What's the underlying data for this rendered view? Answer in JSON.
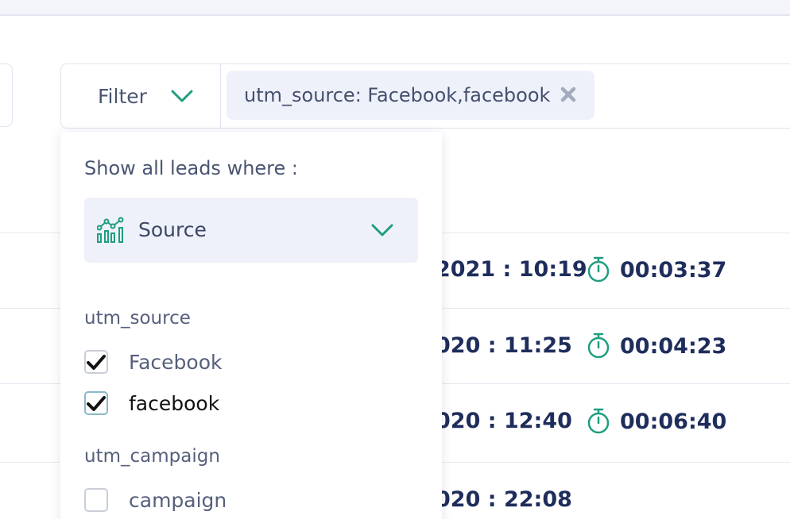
{
  "filter": {
    "label": "Filter"
  },
  "active_chip": {
    "text": "utm_source: Facebook,facebook"
  },
  "dropdown": {
    "heading": "Show all leads where :",
    "select": {
      "value": "Source"
    },
    "groups": [
      {
        "title": "utm_source",
        "options": [
          {
            "label": "Facebook",
            "checked": true
          },
          {
            "label": "facebook",
            "checked": true
          }
        ]
      },
      {
        "title": "utm_campaign",
        "options": [
          {
            "label": "campaign",
            "checked": false
          }
        ]
      }
    ]
  },
  "rows": [
    {
      "date": "2021 : 10:19",
      "duration": "00:03:37"
    },
    {
      "date": "020 : 11:25",
      "duration": "00:04:23"
    },
    {
      "date": "020 : 12:40",
      "duration": "00:06:40"
    },
    {
      "date": "020 : 22:08",
      "duration": ""
    }
  ],
  "colors": {
    "accent": "#1f9e7f",
    "text_dark": "#1f2d5c",
    "chip_bg": "#eff1fa"
  },
  "icons": {
    "filter_chevron": "chevron-down-icon",
    "chip_remove": "close-icon",
    "source": "chart-icon",
    "timer": "stopwatch-icon",
    "check": "check-icon"
  }
}
